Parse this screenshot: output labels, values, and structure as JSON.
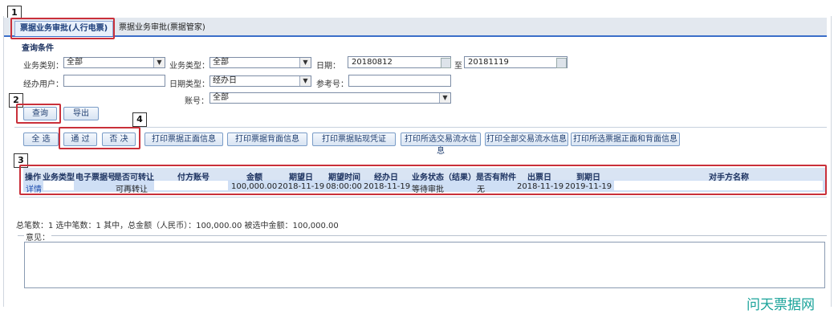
{
  "callouts": [
    "1",
    "2",
    "3",
    "4"
  ],
  "tabs": [
    {
      "label": "票据业务审批(人行电票)",
      "active": true
    },
    {
      "label": "票据业务审批(票据管家)",
      "active": false
    }
  ],
  "query": {
    "section_title": "查询条件",
    "business_category_label": "业务类别：",
    "business_category_value": "全部",
    "business_type_label": "业务类型：",
    "business_type_value": "全部",
    "date_label": "日期：",
    "date_from": "20180812",
    "date_to_label": "至",
    "date_to": "20181119",
    "handler_label": "经办用户：",
    "handler_value": "",
    "date_type_label": "日期类型：",
    "date_type_value": "经办日",
    "ref_label": "参考号：",
    "ref_value": "",
    "account_label": "账号：",
    "account_value": "全部"
  },
  "buttons": {
    "query": "查询",
    "export": "导出",
    "select_all": "全 选",
    "approve": "通 过",
    "reject": "否 决",
    "print_front": "打印票据正面信息",
    "print_back": "打印票据背面信息",
    "print_discount": "打印票据贴现凭证",
    "print_selected_flow": "打印所选交易流水信息",
    "print_all_flow": "打印全部交易流水信息",
    "print_selected_front_back": "打印所选票据正面和背面信息"
  },
  "table": {
    "headers": [
      "操作",
      "业务类型",
      "电子票据号",
      "是否可转让",
      "付方账号",
      "金额",
      "期望日",
      "期望时间",
      "经办日",
      "业务状态（结果）",
      "是否有附件",
      "出票日",
      "到期日",
      "对手方名称"
    ],
    "rows": [
      {
        "action": "详情",
        "business_type": "",
        "bill_no": "",
        "transferable": "可再转让",
        "payer_account": "",
        "amount": "100,000.00",
        "expect_date": "2018-11-19",
        "expect_time": "08:00:00",
        "handle_date": "2018-11-19",
        "status": "等待审批",
        "attachment": "无",
        "issue_date": "2018-11-19",
        "due_date": "2019-11-19",
        "counterparty": ""
      }
    ]
  },
  "summary": "总笔数：1  选中笔数：1  其中，总金额（人民币）：100,000.00  被选中金额：100,000.00",
  "opinion_label": "意见：",
  "watermark": "问天票据网",
  "colors": {
    "highlight_red": "#c9303a",
    "tab_blue": "#3b6ec9",
    "watermark_teal": "#1aa39a"
  }
}
